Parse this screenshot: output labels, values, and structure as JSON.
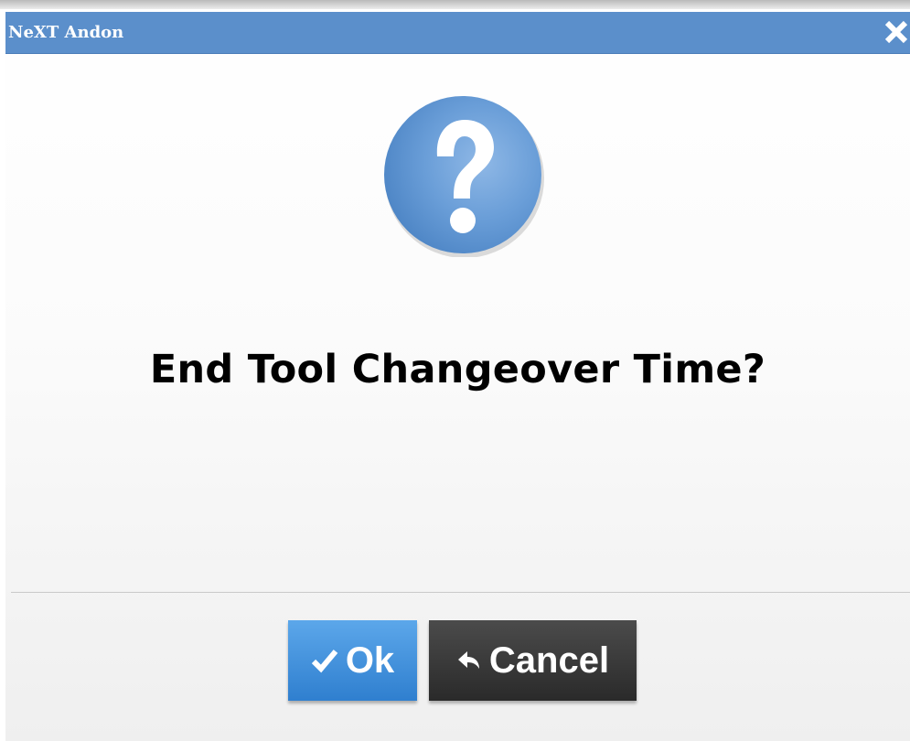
{
  "dialog": {
    "title": "NeXT Andon",
    "message": "End Tool Changeover Time?",
    "icon": "question-icon",
    "close_icon": "close-icon"
  },
  "buttons": {
    "ok_label": "Ok",
    "ok_icon": "checkmark-icon",
    "cancel_label": "Cancel",
    "cancel_icon": "reply-arrow-icon"
  },
  "colors": {
    "titlebar": "#5b8fcb",
    "ok_button": "#3a8ad8",
    "cancel_button": "#333333",
    "question_icon": "#5f95d2"
  }
}
